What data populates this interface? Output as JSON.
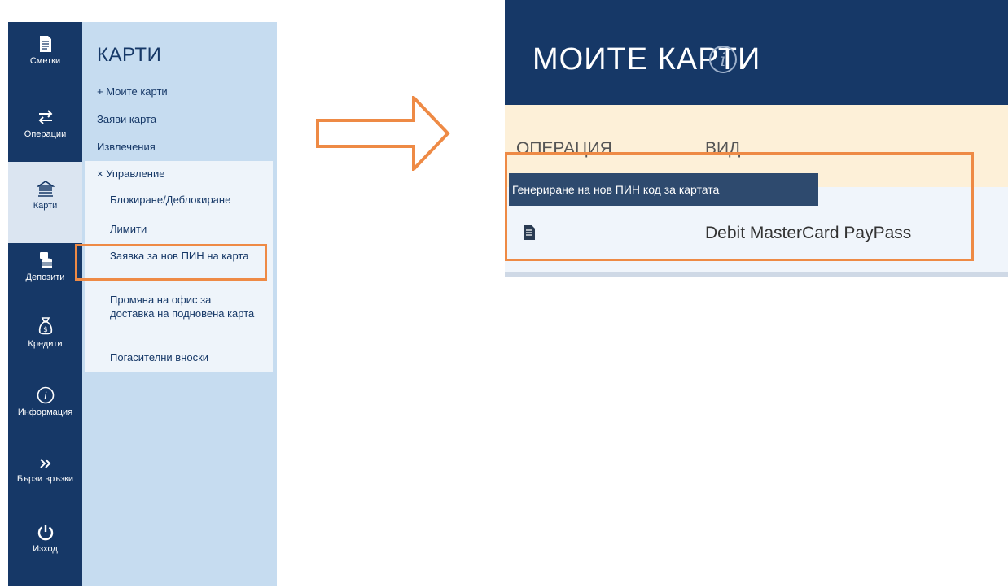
{
  "rail": {
    "items": [
      {
        "label": "Сметки",
        "icon": "document-icon"
      },
      {
        "label": "Операции",
        "icon": "transfer-arrows-icon"
      },
      {
        "label": "Карти",
        "icon": "bank-icon"
      },
      {
        "label": "Депозити",
        "icon": "deposit-icon"
      },
      {
        "label": "Кредити",
        "icon": "money-bag-icon"
      },
      {
        "label": "Информация",
        "icon": "info-icon"
      },
      {
        "label": "Бързи връзки",
        "icon": "double-chevron-icon"
      },
      {
        "label": "Изход",
        "icon": "power-icon"
      }
    ]
  },
  "panel": {
    "title": "КАРТИ",
    "links": [
      "+ Моите карти",
      "Заяви карта",
      "Извлечения"
    ],
    "section": "× Управление",
    "sub_items": [
      "Блокиране/Деблокиране",
      "Лимити",
      "Заявка за нов ПИН на карта",
      "Промяна на офис за доставка на подновена карта",
      "Погасителни вноски"
    ]
  },
  "right": {
    "title": "МОИТЕ КАРТИ",
    "columns": [
      "ОПЕРАЦИЯ",
      "ВИД"
    ],
    "tooltip": "Генериране на нов ПИН код за картата",
    "row_type": "Debit MasterCard PayPass"
  },
  "colors": {
    "navy": "#163867",
    "panel_blue": "#c6dcf0",
    "highlight_orange": "#ee8a45",
    "header_band": "#fdf0d8"
  }
}
